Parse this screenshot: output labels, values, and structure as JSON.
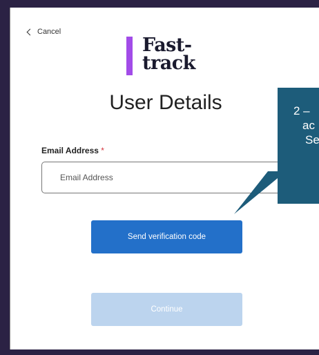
{
  "header": {
    "cancel_label": "Cancel"
  },
  "logo": {
    "line1": "Fast-",
    "line2": "track",
    "bar_color": "#a24ce8"
  },
  "form": {
    "title": "User Details",
    "email_label": "Email Address",
    "required_marker": "*",
    "email_placeholder": "Email Address",
    "email_value": ""
  },
  "buttons": {
    "send_code_label": "Send verification code",
    "continue_label": "Continue",
    "continue_disabled": true
  },
  "callout": {
    "line1": "2 –",
    "line2": "ac",
    "line3": "Se",
    "background": "#1d5c7a"
  },
  "colors": {
    "primary": "#2370c9",
    "primary_disabled": "#bcd4ee",
    "frame": "#2b2244",
    "required": "#d4333b"
  }
}
